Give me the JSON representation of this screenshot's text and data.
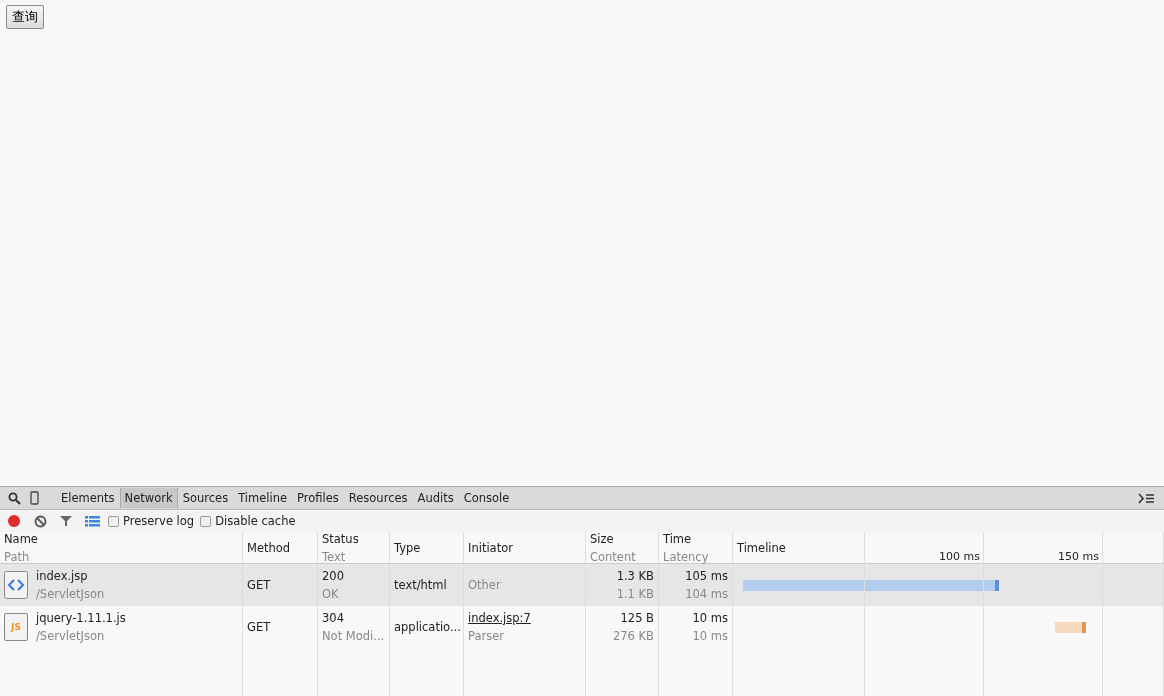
{
  "page": {
    "button": "查询"
  },
  "devtools": {
    "tabs": [
      {
        "label": "Elements",
        "selected": false
      },
      {
        "label": "Network",
        "selected": true
      },
      {
        "label": "Sources",
        "selected": false
      },
      {
        "label": "Timeline",
        "selected": false
      },
      {
        "label": "Profiles",
        "selected": false
      },
      {
        "label": "Resources",
        "selected": false
      },
      {
        "label": "Audits",
        "selected": false
      },
      {
        "label": "Console",
        "selected": false
      }
    ],
    "toolbar": {
      "recording": true,
      "options": [
        {
          "label": "Preserve log",
          "checked": false
        },
        {
          "label": "Disable cache",
          "checked": false
        }
      ]
    },
    "columns": [
      {
        "title": "Name",
        "subtitle": "Path"
      },
      {
        "title": "Method"
      },
      {
        "title": "Status",
        "subtitle": "Text"
      },
      {
        "title": "Type"
      },
      {
        "title": "Initiator"
      },
      {
        "title": "Size",
        "subtitle": "Content"
      },
      {
        "title": "Time",
        "subtitle": "Latency"
      },
      {
        "title": "Timeline"
      }
    ],
    "ticks": [
      "100 ms",
      "150 ms"
    ],
    "rows": [
      {
        "selected": true,
        "kind": "html",
        "name": "index.jsp",
        "path": "/ServletJson",
        "method": "GET",
        "status": "200",
        "status_text": "OK",
        "type": "text/html",
        "initiator": "Other",
        "initiator_link": false,
        "size": "1.3 KB",
        "content": "1.1 KB",
        "time": "105 ms",
        "latency": "104 ms"
      },
      {
        "selected": false,
        "kind": "js",
        "icon_text": "JS",
        "name": "jquery-1.11.1.js",
        "path": "/ServletJson",
        "method": "GET",
        "status": "304",
        "status_text": "Not Modi...",
        "type": "applicatio...",
        "initiator": "index.jsp:7",
        "initiator_sub": "Parser",
        "initiator_link": true,
        "size": "125 B",
        "content": "276 KB",
        "time": "10 ms",
        "latency": "10 ms"
      }
    ]
  }
}
